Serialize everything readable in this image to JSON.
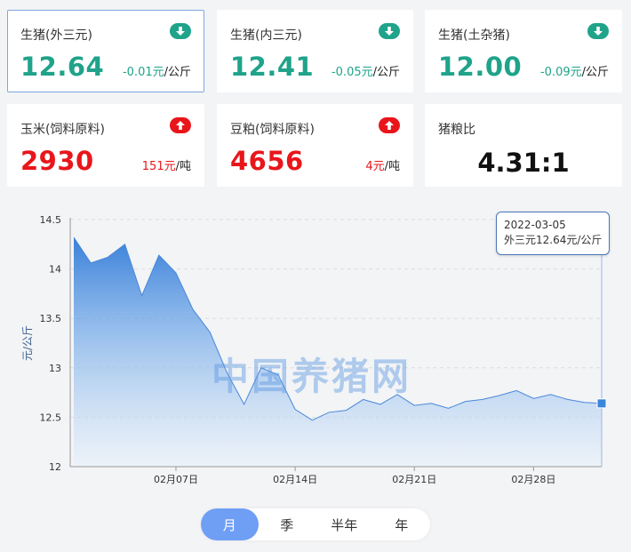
{
  "cards": [
    {
      "label": "生猪(外三元)",
      "price": "12.64",
      "change": "-0.01元",
      "unit": "/公斤",
      "direction": "down",
      "selected": true
    },
    {
      "label": "生猪(内三元)",
      "price": "12.41",
      "change": "-0.05元",
      "unit": "/公斤",
      "direction": "down",
      "selected": false
    },
    {
      "label": "生猪(土杂猪)",
      "price": "12.00",
      "change": "-0.09元",
      "unit": "/公斤",
      "direction": "down",
      "selected": false
    },
    {
      "label": "玉米(饲料原料)",
      "price": "2930",
      "change": "151元",
      "unit": "/吨",
      "direction": "up",
      "selected": false
    },
    {
      "label": "豆粕(饲料原料)",
      "price": "4656",
      "change": "4元",
      "unit": "/吨",
      "direction": "up",
      "selected": false
    },
    {
      "label": "猪粮比",
      "price": "4.31:1",
      "change": "",
      "unit": "",
      "direction": "none",
      "selected": false
    }
  ],
  "colors": {
    "down": "#1fa38a",
    "up": "#e8161b",
    "line": "#4a88d8",
    "accent": "#6f9ef5"
  },
  "watermark": "中国养猪网",
  "tooltip": {
    "date": "2022-03-05",
    "value_text": "外三元12.64元/公斤"
  },
  "tabs": [
    {
      "label": "月",
      "active": true
    },
    {
      "label": "季",
      "active": false
    },
    {
      "label": "半年",
      "active": false
    },
    {
      "label": "年",
      "active": false
    }
  ],
  "chart_data": {
    "type": "area",
    "ylabel": "元/公斤",
    "ylim": [
      12,
      14.5
    ],
    "yticks": [
      "12",
      "12.5",
      "13",
      "13.5",
      "14",
      "14.5"
    ],
    "xticklabels": [
      {
        "label": "02月07日",
        "index": 6
      },
      {
        "label": "02月14日",
        "index": 13
      },
      {
        "label": "02月21日",
        "index": 20
      },
      {
        "label": "02月28日",
        "index": 27
      }
    ],
    "grid": "horizontal-dashed",
    "series": [
      {
        "values": [
          14.32,
          14.06,
          14.12,
          14.25,
          13.73,
          14.14,
          13.96,
          13.59,
          13.36,
          12.95,
          12.63,
          13.0,
          12.93,
          12.58,
          12.47,
          12.55,
          12.57,
          12.68,
          12.63,
          12.73,
          12.62,
          12.64,
          12.59,
          12.66,
          12.68,
          12.72,
          12.77,
          12.69,
          12.73,
          12.68,
          12.65,
          12.64
        ]
      }
    ]
  }
}
